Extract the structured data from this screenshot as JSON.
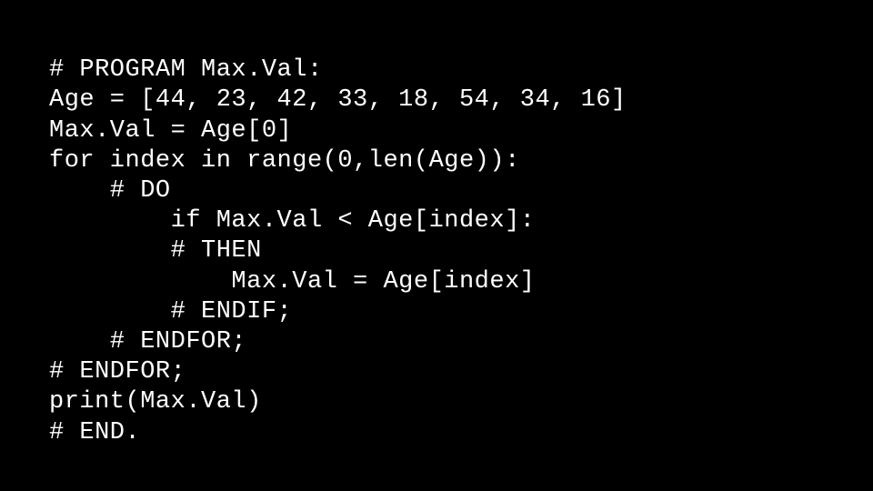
{
  "code": {
    "lines": [
      "# PROGRAM Max.Val:",
      "Age = [44, 23, 42, 33, 18, 54, 34, 16]",
      "Max.Val = Age[0]",
      "for index in range(0,len(Age)):",
      "    # DO",
      "        if Max.Val < Age[index]:",
      "        # THEN",
      "            Max.Val = Age[index]",
      "        # ENDIF;",
      "    # ENDFOR;",
      "# ENDFOR;",
      "print(Max.Val)",
      "# END."
    ]
  }
}
